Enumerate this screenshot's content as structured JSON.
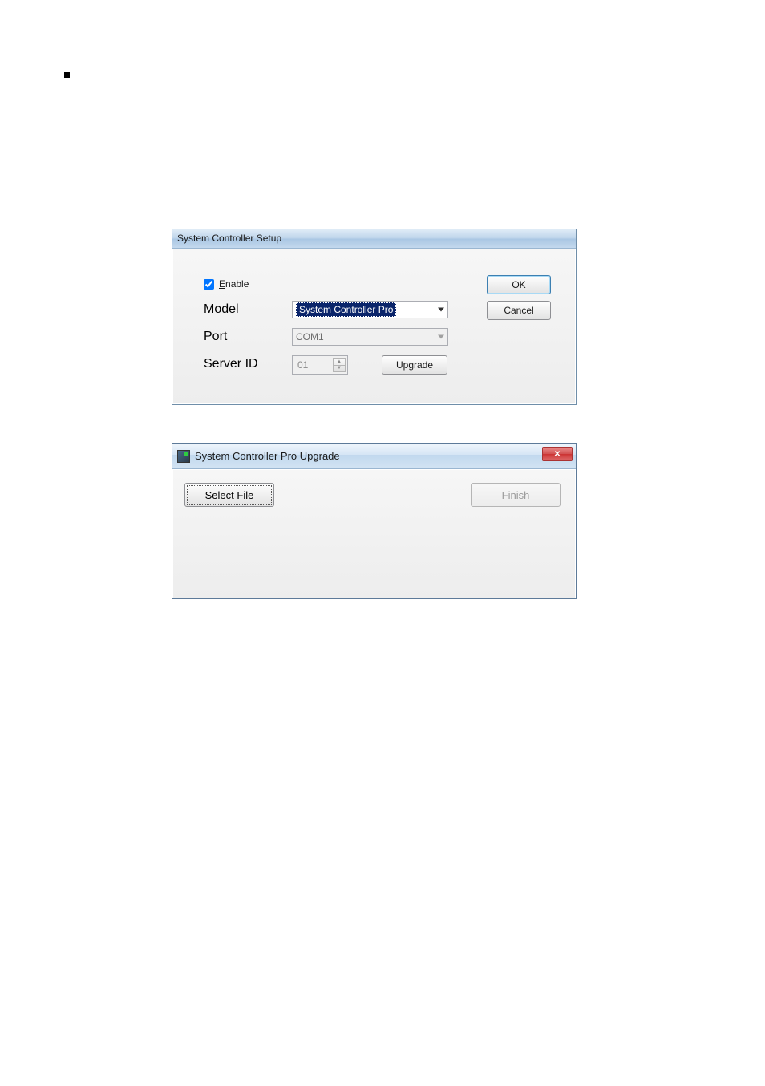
{
  "bullet": "■",
  "dialog1": {
    "title": "System Controller Setup",
    "enable_label": "Enable",
    "enable_checked": true,
    "model_label": "Model",
    "model_value": "System Controller Pro",
    "port_label": "Port",
    "port_value": "COM1",
    "serverid_label": "Server ID",
    "serverid_value": "01",
    "upgrade_label": "Upgrade",
    "ok_label": "OK",
    "cancel_label": "Cancel"
  },
  "dialog2": {
    "title": "System Controller Pro Upgrade",
    "select_file_label": "Select File",
    "finish_label": "Finish",
    "close_symbol": "✕"
  }
}
